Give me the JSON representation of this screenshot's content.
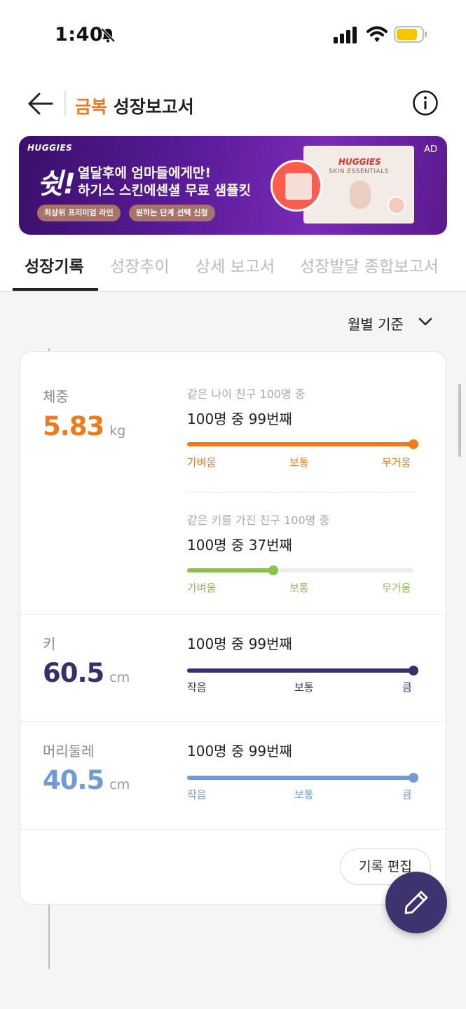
{
  "status_bar": {
    "time": "1:40"
  },
  "header": {
    "child_name": "금복",
    "title": "성장보고서"
  },
  "ad": {
    "brand": "HUGGIES",
    "big_text": "쉿!",
    "line1": "열달후에 엄마들에게만!",
    "line2": "하기스 스킨에센셜 무료 샘플킷",
    "pill1": "최상위 프리미엄 라인",
    "pill2": "원하는 단계 선택 신청",
    "product_brand": "HUGGIES",
    "product_sub": "SKIN ESSENTIALS",
    "label": "AD",
    "color_bg": "#5a1c99"
  },
  "tabs": [
    {
      "label": "성장기록",
      "active": true
    },
    {
      "label": "성장추이",
      "active": false
    },
    {
      "label": "상세 보고서",
      "active": false
    },
    {
      "label": "성장발달 종합보고서",
      "active": false
    }
  ],
  "sort": {
    "label": "월별 기준"
  },
  "weight": {
    "label": "체중",
    "value": "5.83",
    "unit": "kg",
    "color": "#f07a1a",
    "age_caption": "같은 나이 친구 100명 중",
    "age_rank": "100명 중 99번째",
    "age_percent": 100,
    "age_scale": [
      "가벼움",
      "보통",
      "무거움"
    ],
    "height_caption": "같은 키를 가진 친구 100명 중",
    "height_rank": "100명 중 37번째",
    "height_percent": 38,
    "height_color": "#8bc34a",
    "height_scale": [
      "가벼움",
      "보통",
      "무거움"
    ]
  },
  "height": {
    "label": "키",
    "value": "60.5",
    "unit": "cm",
    "color": "#3b2d6b",
    "rank": "100명 중 99번째",
    "percent": 100,
    "scale": [
      "작음",
      "보통",
      "큼"
    ]
  },
  "head": {
    "label": "머리둘레",
    "value": "40.5",
    "unit": "cm",
    "color": "#6f9bd6",
    "rank": "100명 중 99번째",
    "percent": 100,
    "scale": [
      "작음",
      "보통",
      "큼"
    ]
  },
  "edit_button": {
    "label": "기록 편집"
  },
  "icons": {
    "back": "back-arrow-icon",
    "info": "info-icon",
    "fab": "pencil-icon",
    "sort": "chevron-down-icon"
  }
}
